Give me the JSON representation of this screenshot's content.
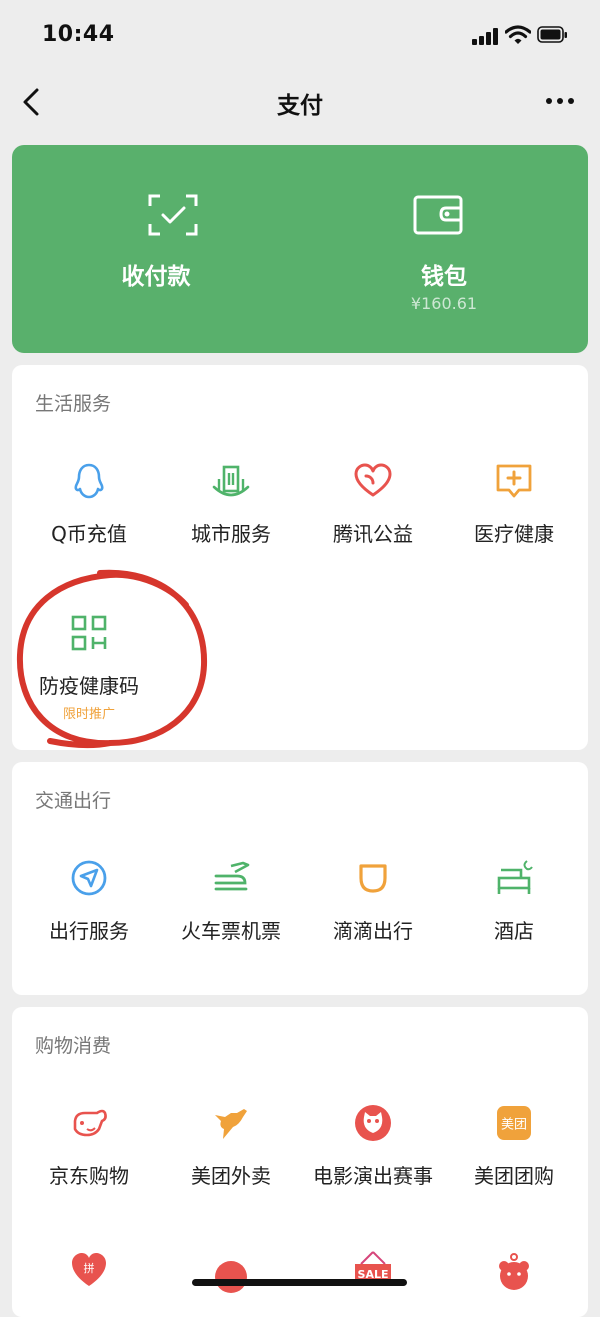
{
  "status_bar": {
    "time": "10:44"
  },
  "nav": {
    "title": "支付",
    "back_icon": "chevron-left-icon",
    "more_icon": "ellipsis-icon"
  },
  "hero": {
    "pay": {
      "label": "收付款",
      "icon": "scan-pay-icon"
    },
    "wallet": {
      "label": "钱包",
      "balance": "¥160.61",
      "icon": "wallet-icon"
    }
  },
  "sections": {
    "life": {
      "title": "生活服务",
      "items": [
        {
          "label": "Q币充值",
          "icon": "qq-penguin-icon"
        },
        {
          "label": "城市服务",
          "icon": "city-building-icon"
        },
        {
          "label": "腾讯公益",
          "icon": "charity-heart-icon"
        },
        {
          "label": "医疗健康",
          "icon": "medical-chat-icon"
        },
        {
          "label": "防疫健康码",
          "icon": "qr-code-icon",
          "tag": "限时推广"
        }
      ]
    },
    "transport": {
      "title": "交通出行",
      "items": [
        {
          "label": "出行服务",
          "icon": "navigation-arrow-icon"
        },
        {
          "label": "火车票机票",
          "icon": "train-plane-icon"
        },
        {
          "label": "滴滴出行",
          "icon": "didi-icon"
        },
        {
          "label": "酒店",
          "icon": "hotel-bed-icon"
        }
      ]
    },
    "shopping": {
      "title": "购物消费",
      "items": [
        {
          "label": "京东购物",
          "icon": "jd-dog-icon"
        },
        {
          "label": "美团外卖",
          "icon": "kangaroo-icon"
        },
        {
          "label": "电影演出赛事",
          "icon": "cat-eye-icon"
        },
        {
          "label": "美团团购",
          "icon": "meituan-icon",
          "icon_text": "美团"
        }
      ],
      "partial_icons": [
        "pinduoduo-heart-icon",
        "red-circle-icon",
        "sale-tag-icon",
        "bear-icon"
      ],
      "partial_texts": {
        "pinduoduo": "拼",
        "sale": "SALE"
      }
    }
  },
  "colors": {
    "hero_green": "#59b06c",
    "accent_orange": "#f0a23b",
    "accent_red": "#e8534e",
    "accent_blue": "#4aa0ea",
    "accent_green": "#4fb36a",
    "annotation_red": "#d6362c"
  }
}
